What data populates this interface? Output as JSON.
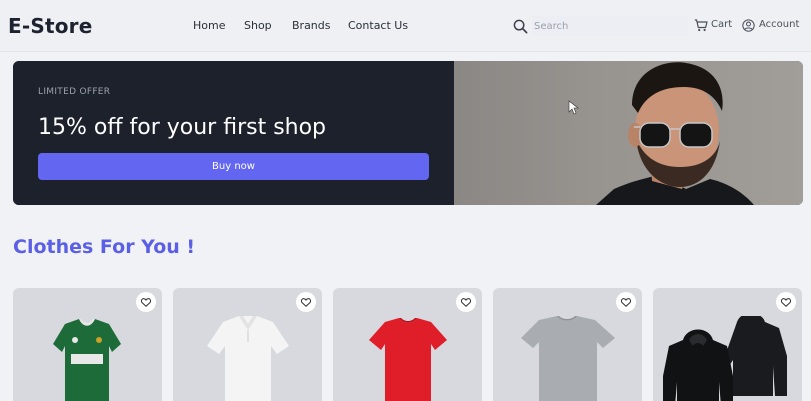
{
  "header": {
    "logo": "E-Store",
    "nav": [
      "Home",
      "Shop",
      "Brands",
      "Contact Us"
    ],
    "search_placeholder": "Search",
    "cart_label": "Cart",
    "account_label": "Account"
  },
  "hero": {
    "offer_label": "LIMITED OFFER",
    "title": "15% off for your first shop",
    "button_label": "Buy now"
  },
  "section": {
    "title": "Clothes For You !"
  },
  "products": [
    {
      "type": "green football jersey"
    },
    {
      "type": "white polo shirt"
    },
    {
      "type": "red t-shirt"
    },
    {
      "type": "grey t-shirt"
    },
    {
      "type": "black hoodies"
    }
  ],
  "colors": {
    "accent": "#6366f1",
    "hero_bg": "#1d212c",
    "section_title": "#5b5fe6"
  }
}
